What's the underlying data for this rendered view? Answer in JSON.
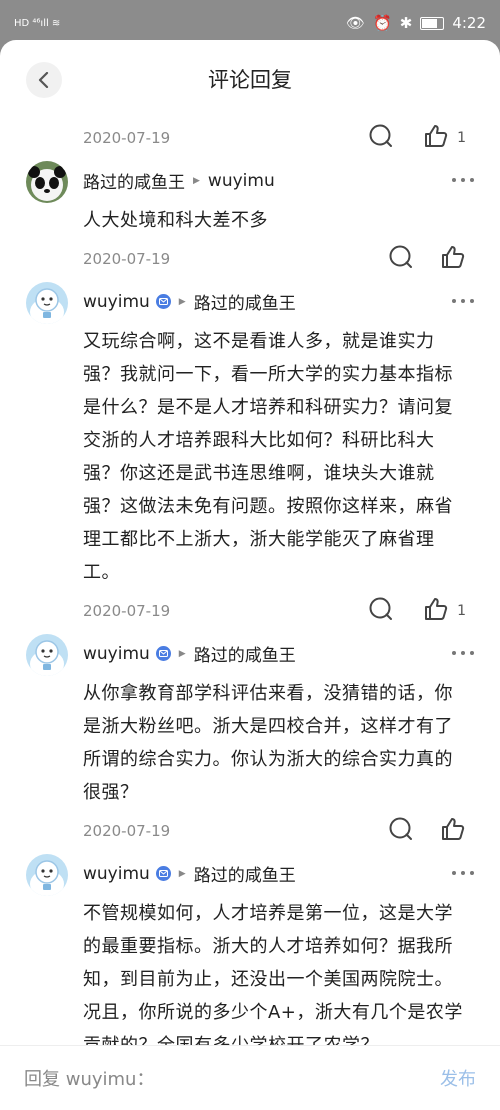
{
  "status": {
    "left": "HD ⁴⁶ıll ≋",
    "time": "4:22"
  },
  "header": {
    "title": "评论回复"
  },
  "replies": [
    {
      "date": "2020-07-19",
      "likes": "1",
      "author": "路过的咸鱼王",
      "to": "wuyimu",
      "avatar": "panda",
      "verified": false,
      "text": "人大处境和科大差不多"
    },
    {
      "date": "2020-07-19",
      "likes": "",
      "author": "wuyimu",
      "to": "路过的咸鱼王",
      "avatar": "blue",
      "verified": true,
      "text": "又玩综合啊，这不是看谁人多，就是谁实力强？我就问一下，看一所大学的实力基本指标是什么？是不是人才培养和科研实力？请问复交浙的人才培养跟科大比如何？科研比科大强？你这还是武书连思维啊，谁块头大谁就强？这做法未免有问题。按照你这样来，麻省理工都比不上浙大，浙大能学能灭了麻省理工。"
    },
    {
      "date": "2020-07-19",
      "likes": "1",
      "author": "wuyimu",
      "to": "路过的咸鱼王",
      "avatar": "blue",
      "verified": true,
      "text": "从你拿教育部学科评估来看，没猜错的话，你是浙大粉丝吧。浙大是四校合并，这样才有了所谓的综合实力。你认为浙大的综合实力真的很强？"
    },
    {
      "date": "2020-07-19",
      "likes": "",
      "author": "wuyimu",
      "to": "路过的咸鱼王",
      "avatar": "blue",
      "verified": true,
      "text": "不管规模如何，人才培养是第一位，这是大学的最重要指标。浙大的人才培养如何？据我所知，到目前为止，还没出一个美国两院院士。况且，你所说的多少个A+，浙大有几个是农学贡献的？全国有多少学校开了农学？"
    }
  ],
  "footer": {
    "reply_placeholder": "回复 wuyimu：",
    "send_label": "发布"
  },
  "colors": {
    "accent": "#4a7de2",
    "send": "#9bbfe8",
    "meta": "#8a8a8a"
  }
}
